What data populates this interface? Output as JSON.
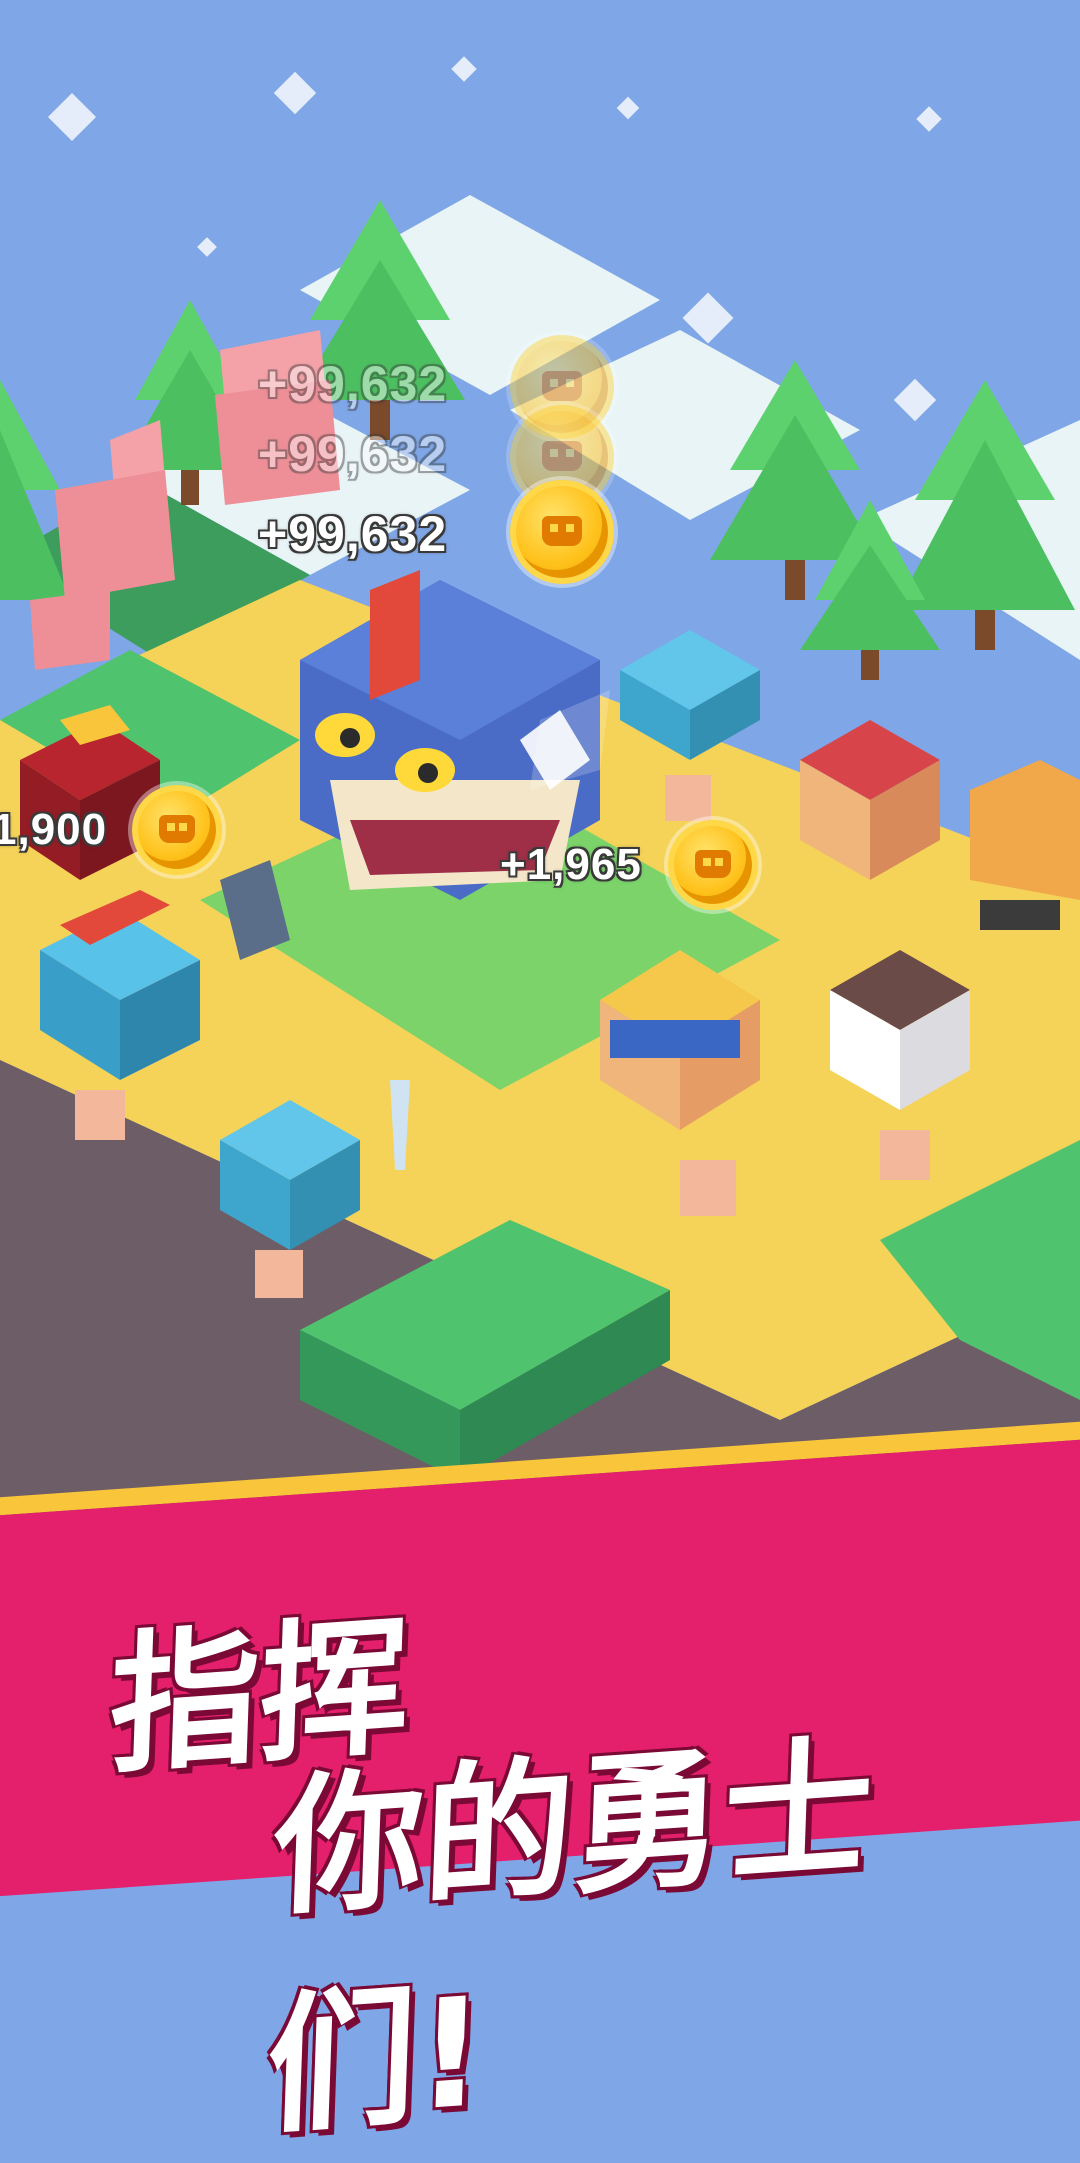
{
  "rewards": {
    "stack": [
      "+99,632",
      "+99,632",
      "+99,632"
    ],
    "left_partial": "1,900",
    "hero_reward": "+1,965"
  },
  "slogan": {
    "line1": "指挥",
    "line2": "你的勇士们!"
  },
  "colors": {
    "sky": "#7fa6e6",
    "grass": "#4fc36d",
    "path": "#f5d258",
    "banner": "#e41f6c",
    "banner_stripe": "#f8c53b",
    "coin": "#ffc21c"
  }
}
